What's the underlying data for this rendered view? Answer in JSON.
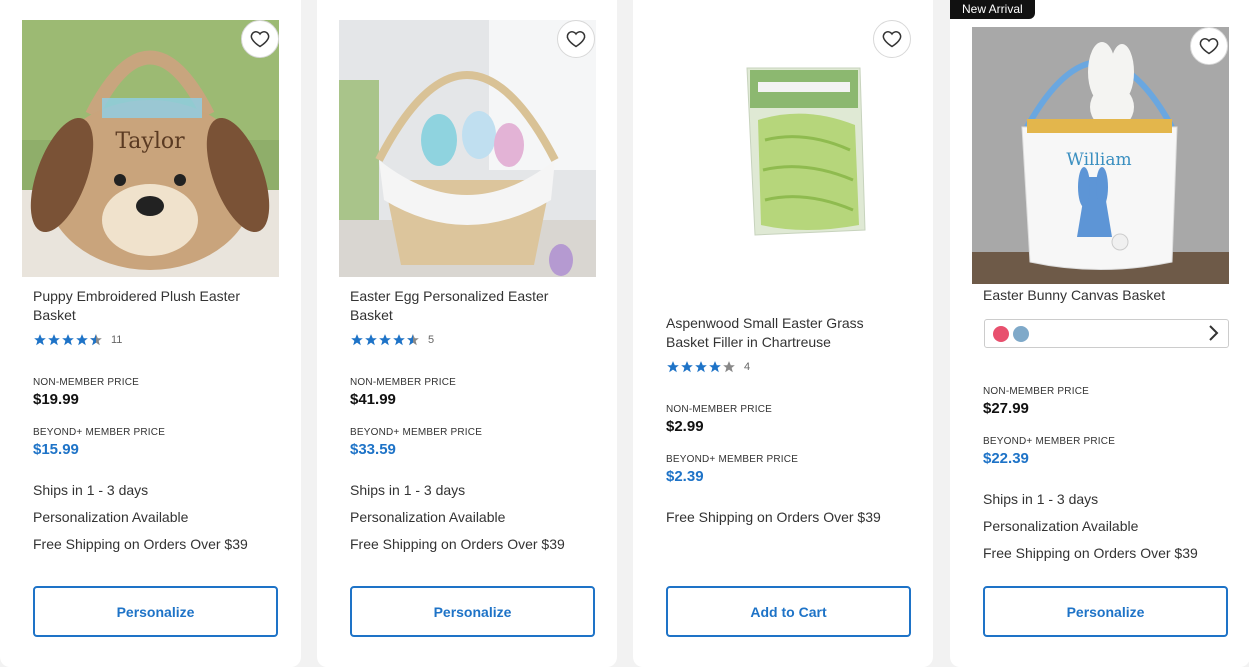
{
  "products": [
    {
      "title": "Puppy Embroidered Plush Easter Basket",
      "image_text": "Taylor",
      "rating": 4.5,
      "review_count": "11",
      "nonmember_label": "NON-MEMBER PRICE",
      "nonmember_price": "$19.99",
      "member_label": "BEYOND+ MEMBER PRICE",
      "member_price": "$15.99",
      "info": [
        "Ships in 1 - 3 days",
        "Personalization Available",
        "Free Shipping on Orders Over $39"
      ],
      "button_label": "Personalize"
    },
    {
      "title": "Easter Egg Personalized Easter Basket",
      "rating": 4.5,
      "review_count": "5",
      "nonmember_label": "NON-MEMBER PRICE",
      "nonmember_price": "$41.99",
      "member_label": "BEYOND+ MEMBER PRICE",
      "member_price": "$33.59",
      "info": [
        "Ships in 1 - 3 days",
        "Personalization Available",
        "Free Shipping on Orders Over $39"
      ],
      "button_label": "Personalize"
    },
    {
      "title": "Aspenwood Small Easter Grass Basket Filler in Chartreuse",
      "rating": 4,
      "review_count": "4",
      "nonmember_label": "NON-MEMBER PRICE",
      "nonmember_price": "$2.99",
      "member_label": "BEYOND+ MEMBER PRICE",
      "member_price": "$2.39",
      "info": [
        "Free Shipping on Orders Over $39"
      ],
      "button_label": "Add to Cart"
    },
    {
      "badge": "New Arrival",
      "title": "Easter Bunny Canvas Basket",
      "image_text": "William",
      "swatch_colors": [
        "#e8506e",
        "#7fa9c9"
      ],
      "nonmember_label": "NON-MEMBER PRICE",
      "nonmember_price": "$27.99",
      "member_label": "BEYOND+ MEMBER PRICE",
      "member_price": "$22.39",
      "info": [
        "Ships in 1 - 3 days",
        "Personalization Available",
        "Free Shipping on Orders Over $39"
      ],
      "button_label": "Personalize"
    }
  ],
  "icons": {
    "favorite": "heart-outline-icon",
    "star": "star-icon",
    "next": "chevron-right-icon"
  },
  "colors": {
    "accent": "#1e73c7",
    "star": "#1e73c7",
    "star_empty": "#888888",
    "badge_bg": "#111111"
  }
}
